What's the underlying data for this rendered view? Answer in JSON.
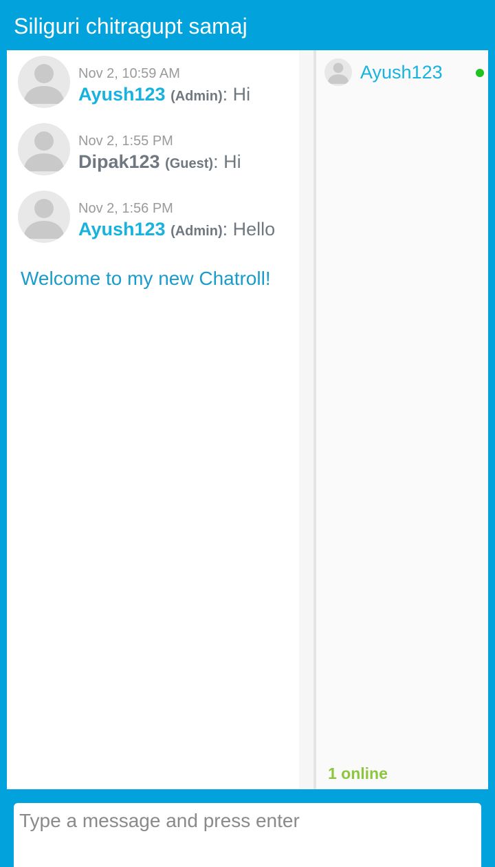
{
  "header": {
    "title": "Siliguri chitragupt samaj"
  },
  "messages": [
    {
      "time": "Nov 2, 10:59 AM",
      "author": "Ayush123",
      "role": "(Admin)",
      "separator": ":",
      "text": "Hi"
    },
    {
      "time": "Nov 2, 1:55 PM",
      "author": "Dipak123",
      "role": "(Guest)",
      "separator": ":",
      "text": "Hi"
    },
    {
      "time": "Nov 2, 1:56 PM",
      "author": "Ayush123",
      "role": "(Admin)",
      "separator": ":",
      "text": "Hello"
    }
  ],
  "welcome_text": "Welcome to my new Chatroll!",
  "users": [
    {
      "name": "Ayush123",
      "status": "online"
    }
  ],
  "online_count": "1 online",
  "composer": {
    "placeholder": "Type a message and press enter"
  },
  "colors": {
    "accent": "#02a3dc",
    "admin_name": "#17b3de",
    "online": "#1fc21f",
    "online_count": "#8cc63f"
  },
  "icons": {
    "avatar": "default-user-silhouette-icon",
    "status": "online-dot-icon"
  }
}
